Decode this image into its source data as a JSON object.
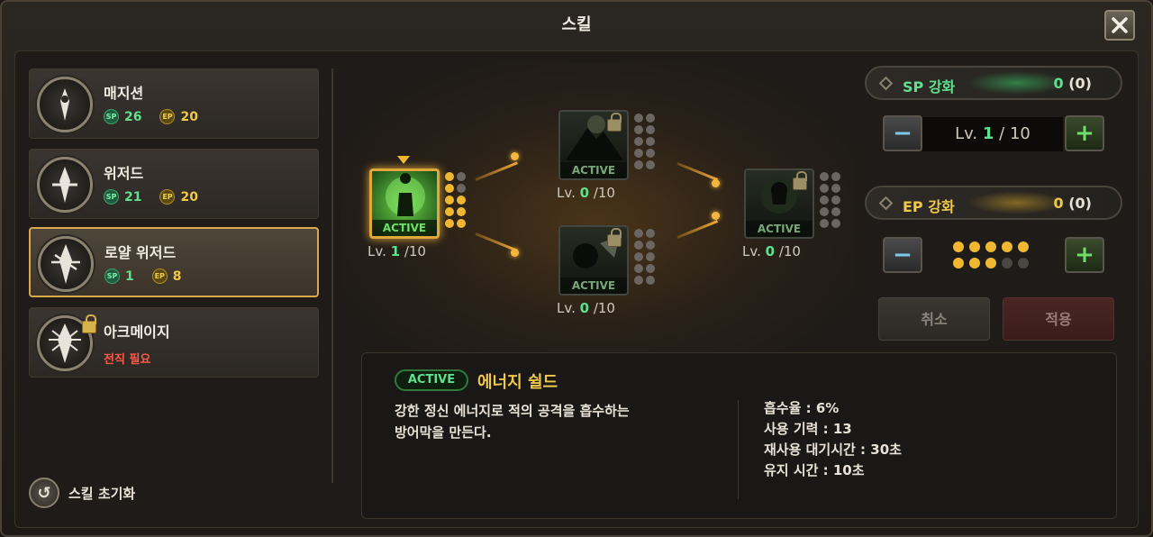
{
  "window": {
    "title": "스킬"
  },
  "classes": [
    {
      "name": "매지션",
      "sp": "26",
      "ep": "20",
      "locked": false,
      "selected": false
    },
    {
      "name": "위저드",
      "sp": "21",
      "ep": "20",
      "locked": false,
      "selected": false
    },
    {
      "name": "로얄 위저드",
      "sp": "1",
      "ep": "8",
      "locked": false,
      "selected": true
    },
    {
      "name": "아크메이지",
      "requirement": "전직 필요",
      "locked": true,
      "selected": false
    }
  ],
  "badges": {
    "sp": "SP",
    "ep": "EP"
  },
  "reset_label": "스킬 초기화",
  "tree": {
    "nodes": [
      {
        "id": "energy-shield",
        "tag": "ACTIVE",
        "level": "1",
        "max": "10",
        "active_dots": 8,
        "total_dots": 10,
        "locked": false
      },
      {
        "id": "mountain",
        "tag": "ACTIVE",
        "level": "0",
        "max": "10",
        "active_dots": 0,
        "total_dots": 10,
        "locked": true
      },
      {
        "id": "leaf",
        "tag": "ACTIVE",
        "level": "0",
        "max": "10",
        "active_dots": 0,
        "total_dots": 10,
        "locked": true
      },
      {
        "id": "skull",
        "tag": "ACTIVE",
        "level": "0",
        "max": "10",
        "active_dots": 0,
        "total_dots": 10,
        "locked": true
      }
    ],
    "lv_prefix": "Lv."
  },
  "upgrade": {
    "sp_label": "SP 강화",
    "sp_value": "0",
    "sp_extra": "(0)",
    "level_prefix": "Lv.",
    "level_current": "1",
    "level_max": "/ 10",
    "ep_label": "EP 강화",
    "ep_value": "0",
    "ep_extra": "(0)",
    "ep_dots_on": 8,
    "ep_dots_total": 10,
    "cancel_label": "취소",
    "apply_label": "적용"
  },
  "info": {
    "tag": "ACTIVE",
    "skill_name": "에너지 쉴드",
    "description_1": "강한 정신 에너지로 적의 공격을 흡수하는",
    "description_2": "방어막을 만든다.",
    "stats": [
      "흡수율 : 6%",
      "사용 기력 : 13",
      "재사용 대기시간 : 30초",
      "유지 시간 : 10초"
    ]
  },
  "colors": {
    "accent_gold": "#f0b830",
    "sp_green": "#5ee08c",
    "warn_red": "#ff5a4a"
  }
}
